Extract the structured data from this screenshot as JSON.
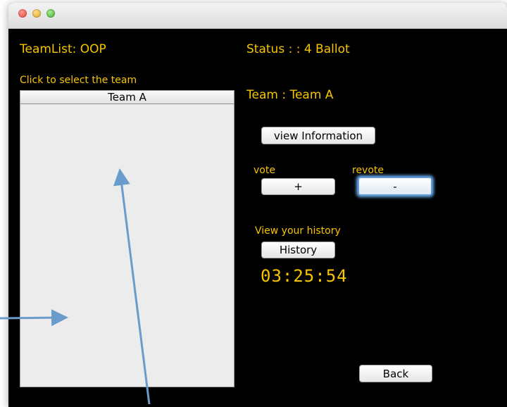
{
  "window": {
    "team_list_title": "TeamList: OOP",
    "select_prompt": "Click to select the team",
    "status": "Status :  : 4 Ballot",
    "team_heading": "Team : Team A"
  },
  "team_list": {
    "items": [
      "Team A"
    ]
  },
  "buttons": {
    "view_info": "view Information",
    "vote_label": "vote",
    "revote_label": "revote",
    "vote_plus": "+",
    "revote_minus": "-",
    "history_prompt": "View your history",
    "history": "History",
    "back": "Back"
  },
  "timer": "03:25:54",
  "colors": {
    "label": "#f7c500",
    "background": "#000000",
    "annotation_arrow": "#6a9ccb"
  }
}
